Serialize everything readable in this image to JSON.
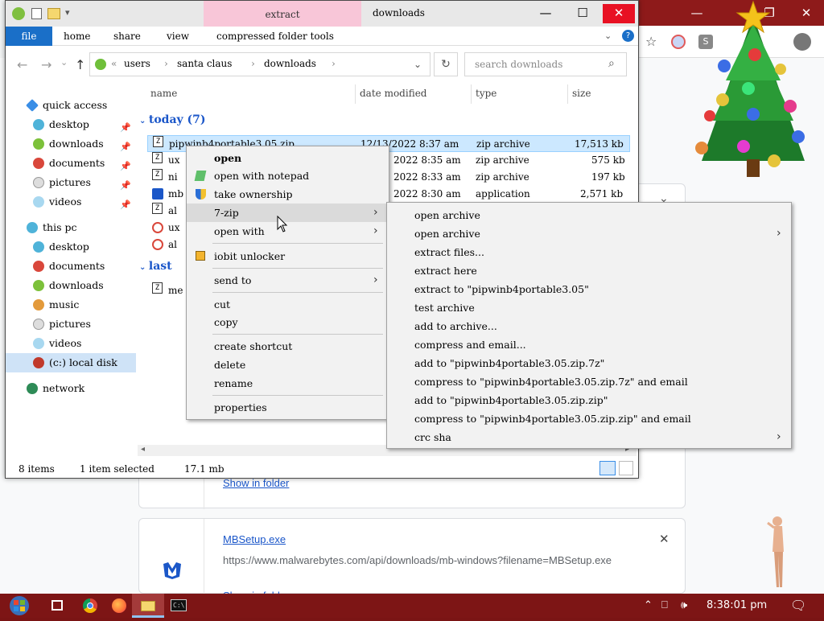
{
  "explorer": {
    "title": "downloads",
    "contextual_tab": "extract",
    "ribbon_tabs": [
      "file",
      "home",
      "share",
      "view",
      "compressed folder tools"
    ],
    "address_crumbs": [
      "users",
      "santa claus",
      "downloads"
    ],
    "search_placeholder": "search downloads",
    "columns": [
      "name",
      "date modified",
      "type",
      "size"
    ],
    "groups": [
      {
        "label": "today (7)"
      },
      {
        "label": "last"
      }
    ],
    "files": [
      {
        "name": "pipwinb4portable3.05.zip",
        "date": "12/13/2022 8:37 am",
        "type": "zip archive",
        "size": "17,513 kb",
        "selected": true
      },
      {
        "name": "ux",
        "date": "2022 8:35 am",
        "type": "zip archive",
        "size": "575 kb"
      },
      {
        "name": "ni",
        "date": "2022 8:33 am",
        "type": "zip archive",
        "size": "197 kb"
      },
      {
        "name": "mb",
        "date": "2022 8:30 am",
        "type": "application",
        "size": "2,571 kb"
      },
      {
        "name": "al",
        "date": "",
        "type": "",
        "size": ""
      },
      {
        "name": "ux",
        "date": "",
        "type": "",
        "size": ""
      },
      {
        "name": "al",
        "date": "",
        "type": "",
        "size": ""
      },
      {
        "name": "me",
        "date": "",
        "type": "",
        "size": ""
      }
    ],
    "nav": {
      "quick_access": "quick access",
      "quick_items": [
        "desktop",
        "downloads",
        "documents",
        "pictures",
        "videos"
      ],
      "this_pc": "this pc",
      "pc_items": [
        "desktop",
        "documents",
        "downloads",
        "music",
        "pictures",
        "videos",
        "(c:) local disk"
      ],
      "network": "network"
    },
    "status": {
      "items": "8 items",
      "selected": "1 item selected",
      "size": "17.1 mb"
    }
  },
  "context_menu": {
    "items": [
      "open",
      "open with notepad",
      "take ownership",
      "7-zip",
      "open with",
      "iobit unlocker",
      "send to",
      "cut",
      "copy",
      "create shortcut",
      "delete",
      "rename",
      "properties"
    ]
  },
  "submenu_7zip": {
    "items": [
      "open archive",
      "open archive",
      "extract files...",
      "extract here",
      "extract to \"pipwinb4portable3.05\"",
      "test archive",
      "add to archive...",
      "compress and email...",
      "add to \"pipwinb4portable3.05.zip.7z\"",
      "compress to \"pipwinb4portable3.05.zip.7z\" and email",
      "add to \"pipwinb4portable3.05.zip.zip\"",
      "compress to \"pipwinb4portable3.05.zip.zip\" and email",
      "crc sha"
    ]
  },
  "browser": {
    "show_in_folder": "Show in folder",
    "download2_name": "MBSetup.exe",
    "download2_url": "https://www.malwarebytes.com/api/downloads/mb-windows?filename=MBSetup.exe",
    "download2_partial": "Show in folder",
    "close_glyph": "✕"
  },
  "taskbar": {
    "time": "8:38:01 pm"
  },
  "colors": {
    "accent": "#1a6fc8",
    "taskbar": "#7d1515",
    "close_red": "#e81123",
    "contextual_pink": "#f8c6d8"
  }
}
